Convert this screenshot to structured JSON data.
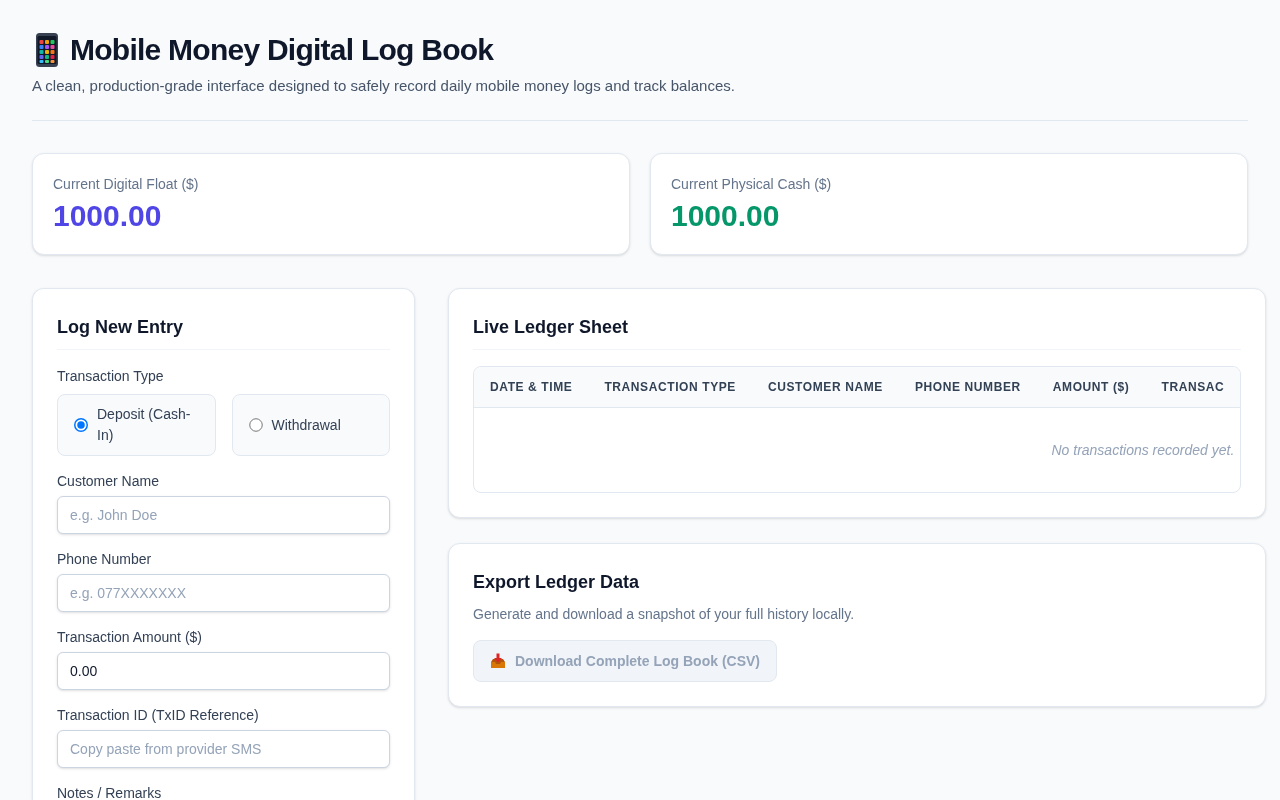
{
  "header": {
    "title": "Mobile Money Digital Log Book",
    "subtitle": "A clean, production-grade interface designed to safely record daily mobile money logs and track balances."
  },
  "balances": [
    {
      "label": "Current Digital Float ($)",
      "value": "1000.00",
      "color": "#4f46e5"
    },
    {
      "label": "Current Physical Cash ($)",
      "value": "1000.00",
      "color": "#059669"
    }
  ],
  "entry_form": {
    "title": "Log New Entry",
    "transaction_type": {
      "label": "Transaction Type",
      "options": [
        {
          "label": "Deposit (Cash-In)",
          "selected": true
        },
        {
          "label": "Withdrawal",
          "selected": false
        }
      ]
    },
    "fields": [
      {
        "label": "Customer Name",
        "placeholder": "e.g. John Doe"
      },
      {
        "label": "Phone Number",
        "placeholder": "e.g. 077XXXXXXX"
      },
      {
        "label": "Transaction Amount ($)",
        "value": "0.00"
      },
      {
        "label": "Transaction ID (TxID Reference)",
        "placeholder": "Copy paste from provider SMS"
      }
    ],
    "notes": {
      "label": "Notes / Remarks"
    }
  },
  "ledger": {
    "title": "Live Ledger Sheet",
    "columns": [
      "DATE & TIME",
      "TRANSACTION TYPE",
      "CUSTOMER NAME",
      "PHONE NUMBER",
      "AMOUNT ($)",
      "TRANSAC"
    ],
    "empty_message": "No transactions recorded yet."
  },
  "export": {
    "title": "Export Ledger Data",
    "description": "Generate and download a snapshot of your full history locally.",
    "button": {
      "label": "Download Complete Log Book (CSV)",
      "disabled": true
    }
  }
}
